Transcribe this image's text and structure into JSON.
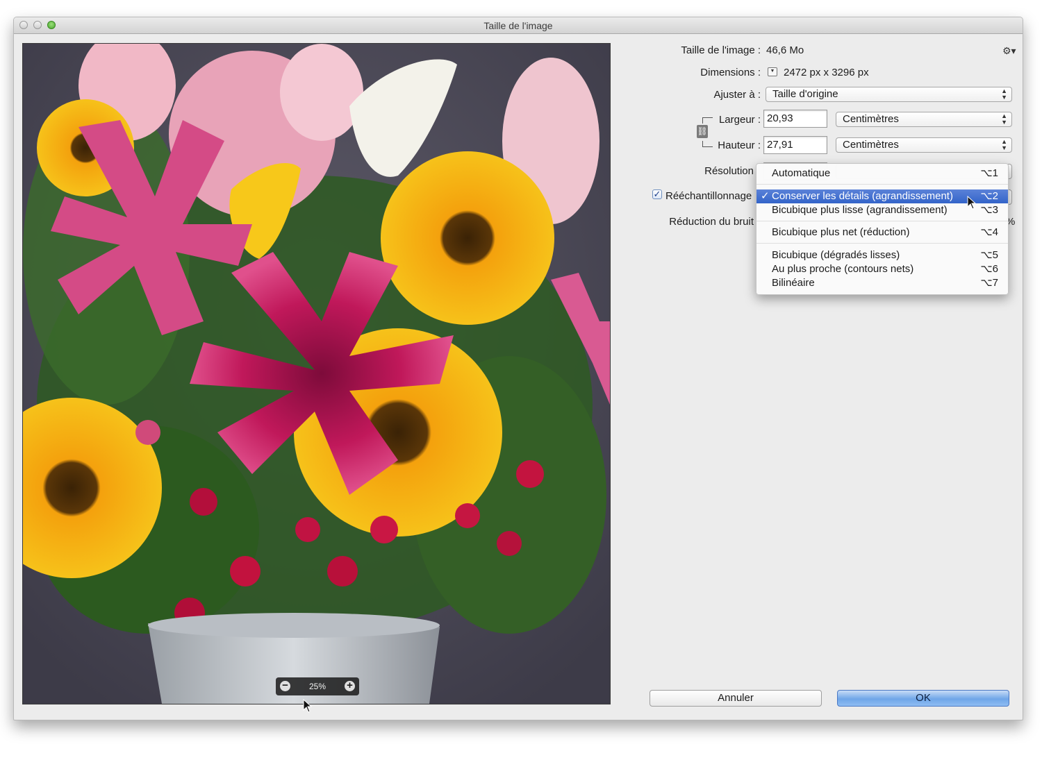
{
  "window": {
    "title": "Taille de l'image"
  },
  "preview": {
    "zoom": "25%",
    "zoom_out_icon": "minus-circle-icon",
    "zoom_in_icon": "plus-circle-icon"
  },
  "info": {
    "size_label": "Taille de l'image :",
    "size_value": "46,6 Mo",
    "dims_label": "Dimensions :",
    "dims_value": "2472 px x 3296 px",
    "fit_label": "Ajuster à :",
    "fit_value": "Taille d'origine"
  },
  "fields": {
    "width_label": "Largeur :",
    "width_value": "20,93",
    "width_unit": "Centimètres",
    "height_label": "Hauteur :",
    "height_value": "27,91",
    "height_unit": "Centimètres",
    "resolution_label": "Résolution",
    "resample_label": "Rééchantillonnage",
    "resample_checked": true,
    "noise_label": "Réduction du bruit",
    "noise_unit": "%"
  },
  "menu": {
    "items": [
      {
        "label": "Automatique",
        "key": "⌥1"
      },
      {
        "label": "Conserver les détails (agrandissement)",
        "key": "⌥2",
        "selected": true,
        "check": "✓"
      },
      {
        "label": "Bicubique plus lisse (agrandissement)",
        "key": "⌥3"
      },
      {
        "label": "Bicubique plus net (réduction)",
        "key": "⌥4"
      },
      {
        "label": "Bicubique (dégradés lisses)",
        "key": "⌥5"
      },
      {
        "label": "Au plus proche (contours nets)",
        "key": "⌥6"
      },
      {
        "label": "Bilinéaire",
        "key": "⌥7"
      }
    ]
  },
  "buttons": {
    "cancel": "Annuler",
    "ok": "OK"
  },
  "colors": {
    "selection": "#3f6fcf",
    "ok_button": "#7fb2ee"
  }
}
